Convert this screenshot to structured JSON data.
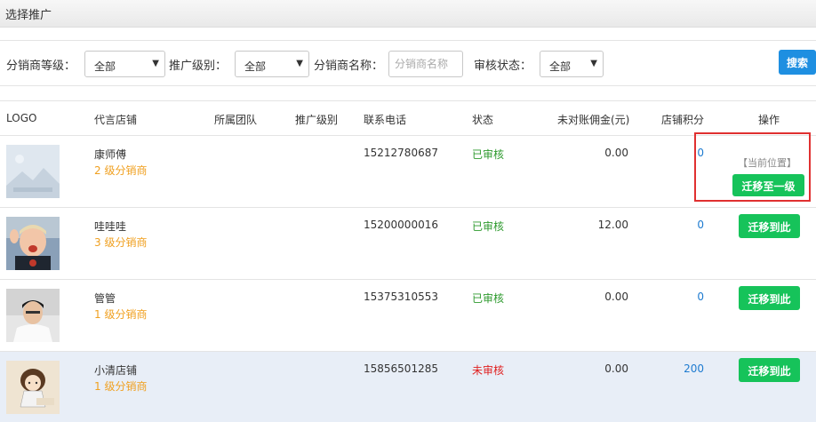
{
  "window": {
    "title": "选择推广"
  },
  "filters": {
    "level_label": "分销商等级：",
    "level_value": "全部",
    "promo_label": "推广级别：",
    "promo_value": "全部",
    "name_label": "分销商名称：",
    "name_placeholder": "分销商名称",
    "status_label": "审核状态：",
    "status_value": "全部",
    "search_label": "搜索"
  },
  "table": {
    "headers": [
      "LOGO",
      "代言店铺",
      "所属团队",
      "推广级别",
      "联系电话",
      "状态",
      "未对账佣金(元)",
      "店铺积分",
      "操作"
    ],
    "rows": [
      {
        "shop": "康师傅",
        "level": "2 级分销商",
        "phone": "15212780687",
        "status": "已审核",
        "amount": "0.00",
        "points": "0",
        "logo_icon": "placeholder-image-icon",
        "current_label": "【当前位置】",
        "action": "迁移至一级"
      },
      {
        "shop": "哇哇哇",
        "level": "3 级分销商",
        "phone": "15200000016",
        "status": "已审核",
        "amount": "12.00",
        "points": "0",
        "logo_icon": "child-photo",
        "action": "迁移到此"
      },
      {
        "shop": "管管",
        "level": "1 级分销商",
        "phone": "15375310553",
        "status": "已审核",
        "amount": "0.00",
        "points": "0",
        "logo_icon": "man-photo",
        "action": "迁移到此"
      },
      {
        "shop": "小清店铺",
        "level": "1 级分销商",
        "phone": "15856501285",
        "status": "未审核",
        "amount": "0.00",
        "points": "200",
        "logo_icon": "cartoon-girl-photo",
        "action": "迁移到此"
      }
    ]
  },
  "colors": {
    "accent_blue": "#1e8fe1",
    "green": "#16c35a",
    "level_orange": "#f0a020",
    "unreviewed_red": "#e02020",
    "highlight_row": "#e8eef7"
  }
}
